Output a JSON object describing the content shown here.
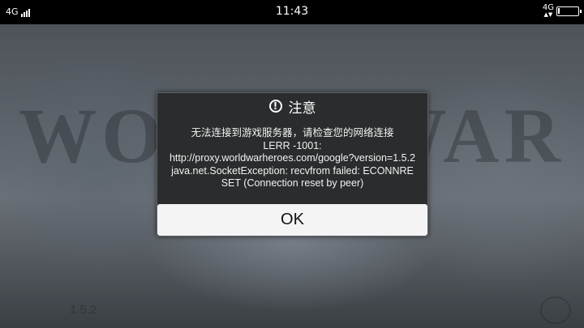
{
  "status_bar": {
    "network_left": "4G",
    "time": "11:43",
    "network_right": "4G",
    "network_right_arrows": "▲▼",
    "battery_level": 0.1
  },
  "dialog": {
    "title": "注意",
    "message_lines": [
      "无法连接到游戏服务器，请检查您的网络连接",
      "LERR -1001:",
      "http://proxy.worldwarheroes.com/google?version=1.5.2 java.net.SocketException: recvfrom failed: ECONNRESET (Connection reset by peer)"
    ],
    "ok_label": "OK"
  },
  "background": {
    "watermark": "WORLD WAR",
    "version": "1.5.2"
  }
}
